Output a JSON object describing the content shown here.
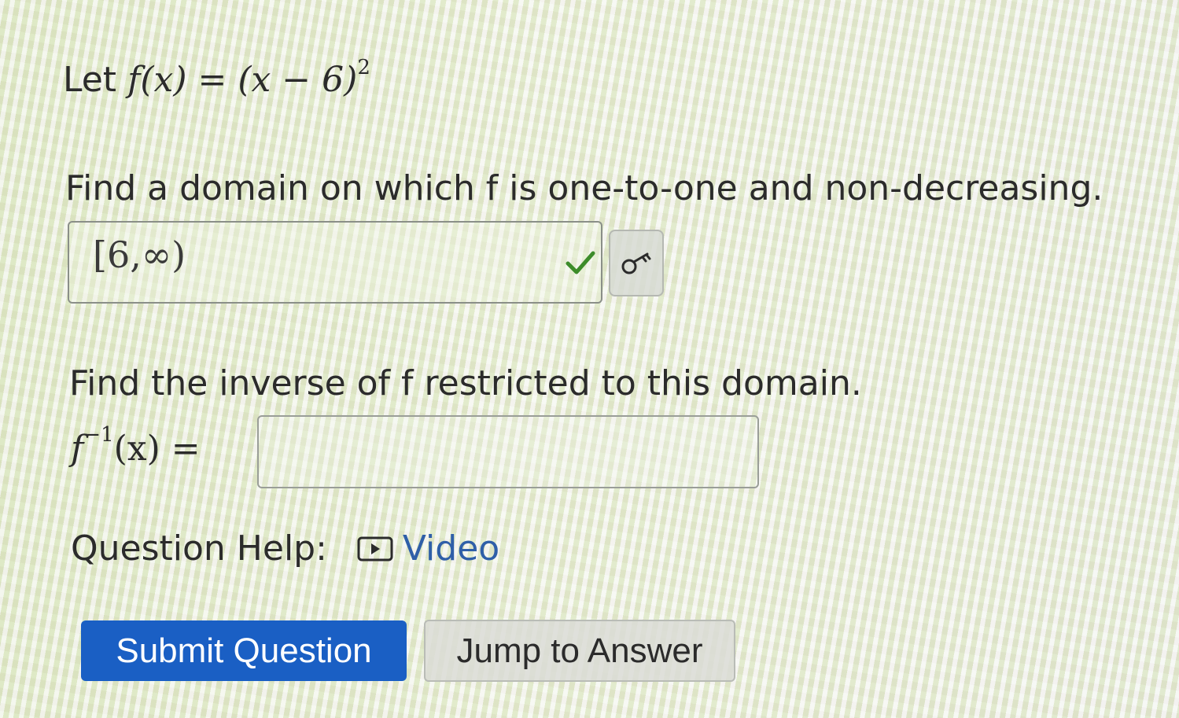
{
  "question": {
    "intro_prefix": "Let",
    "function_definition": "f(x) = (x − 6)",
    "function_exponent": "2",
    "domain_prompt": "Find a domain on which f is one-to-one and non-decreasing.",
    "domain_answer": "[6,∞)",
    "inverse_prompt": "Find the inverse of f restricted to this domain.",
    "inverse_label": "f",
    "inverse_exponent": "−1",
    "inverse_label_suffix": "(x) =",
    "inverse_input_value": ""
  },
  "help": {
    "label": "Question Help:",
    "video_label": "Video"
  },
  "buttons": {
    "submit_label": "Submit Question",
    "jump_label": "Jump to Answer"
  },
  "icons": {
    "correct": "check-icon",
    "key": "key-icon",
    "video": "video-play-icon"
  },
  "colors": {
    "correct_check": "#3d8c2a",
    "submit_bg": "#1a5fc4",
    "link": "#2f5fa8"
  }
}
